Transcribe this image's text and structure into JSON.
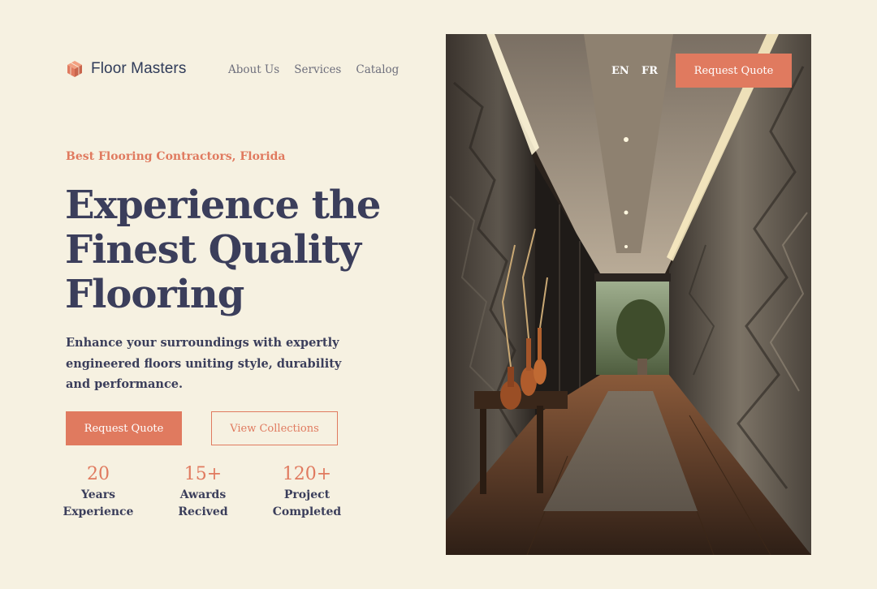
{
  "header": {
    "brand_name": "Floor Masters",
    "brand_icon": "cube-icon",
    "nav": [
      {
        "label": "About Us"
      },
      {
        "label": "Services"
      },
      {
        "label": "Catalog"
      }
    ],
    "languages": [
      "EN",
      "FR"
    ],
    "cta_label": "Request Quote"
  },
  "hero": {
    "eyebrow": "Best Flooring Contractors, Florida",
    "headline_lines": [
      "Experience the",
      "Finest Quality",
      "Flooring"
    ],
    "lead": "Enhance your surroundings with expertly engineered floors uniting style, durability and performance.",
    "primary_cta": "Request Quote",
    "secondary_cta": "View Collections",
    "image_description_icon": "hallway-photo"
  },
  "stats": [
    {
      "value": "20",
      "label_line1": "Years",
      "label_line2": "Experience"
    },
    {
      "value": "15+",
      "label_line1": "Awards",
      "label_line2": "Recived"
    },
    {
      "value": "120+",
      "label_line1": "Project",
      "label_line2": "Completed"
    }
  ],
  "colors": {
    "background": "#f6f1e1",
    "accent": "#e07a5f",
    "text_dark": "#3b3e5b",
    "nav_text": "#6e6f7c"
  }
}
